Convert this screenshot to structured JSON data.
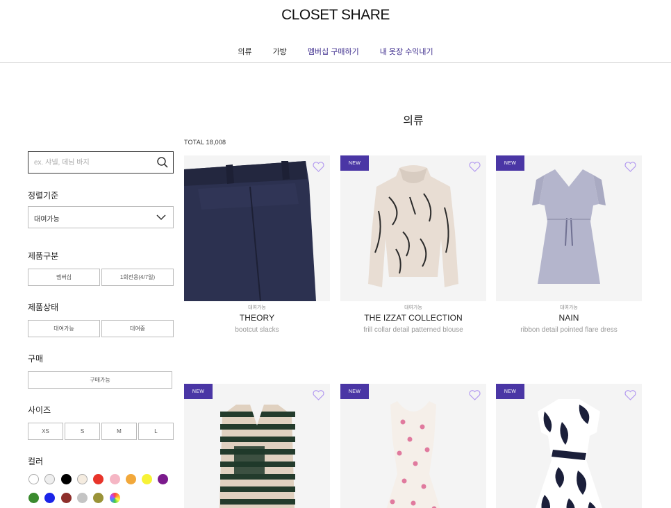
{
  "header": {
    "logo": "CLOSET SHARE",
    "nav": [
      {
        "label": "의류",
        "highlight": false
      },
      {
        "label": "가방",
        "highlight": false
      },
      {
        "label": "멤버십 구매하기",
        "highlight": true
      },
      {
        "label": "내 옷장 수익내기",
        "highlight": true
      }
    ]
  },
  "main": {
    "title": "의류",
    "total": "TOTAL 18,008"
  },
  "sidebar": {
    "search_placeholder": "ex. 샤넬, 데님 바지",
    "sort": {
      "heading": "정렬기준",
      "value": "대여가능"
    },
    "category": {
      "heading": "제품구분",
      "options": [
        "멤버십",
        "1회전용(4/7일)"
      ]
    },
    "condition": {
      "heading": "제품상태",
      "options": [
        "대여가능",
        "대여중"
      ]
    },
    "purchase": {
      "heading": "구매",
      "options": [
        "구매가능"
      ]
    },
    "size": {
      "heading": "사이즈",
      "options": [
        "XS",
        "S",
        "M",
        "L"
      ]
    },
    "color": {
      "heading": "컬러",
      "swatches": [
        "#ffffff",
        "#eeeeee",
        "#000000",
        "#f5ece0",
        "#e8342a",
        "#f5b6c4",
        "#f2a83b",
        "#f7f236",
        "#7b1a8c",
        "#3a8a2e",
        "#1a24e8",
        "#8e2f2b",
        "#c4c4c4",
        "#9a9338",
        "multicolor"
      ]
    }
  },
  "products": [
    {
      "is_new": false,
      "status": "대여가능",
      "brand": "THEORY",
      "desc": "bootcut slacks",
      "art": "slacks"
    },
    {
      "is_new": true,
      "new_label": "NEW",
      "status": "대여가능",
      "brand": "THE IZZAT COLLECTION",
      "desc": "frill collar detail patterned blouse",
      "art": "blouse"
    },
    {
      "is_new": true,
      "new_label": "NEW",
      "status": "대여가능",
      "brand": "NAIN",
      "desc": "ribbon detail pointed flare dress",
      "art": "dress"
    },
    {
      "is_new": true,
      "new_label": "NEW",
      "art": "cardigan"
    },
    {
      "is_new": true,
      "new_label": "NEW",
      "art": "polka-dress"
    },
    {
      "is_new": true,
      "new_label": "NEW",
      "art": "floral-dress"
    }
  ]
}
